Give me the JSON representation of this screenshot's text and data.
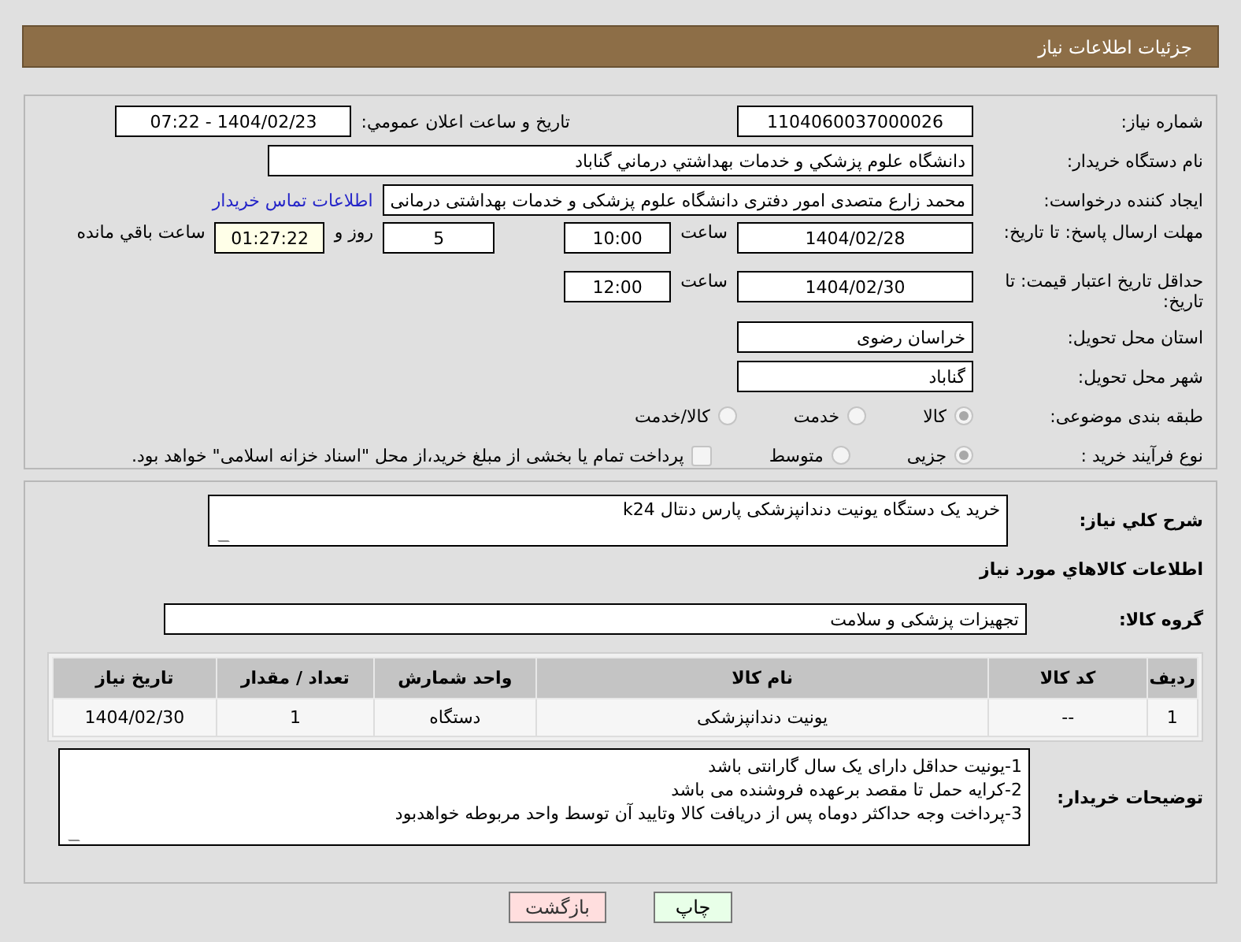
{
  "header": {
    "title": "جزئیات اطلاعات نیاز"
  },
  "need_number": {
    "label": "شماره نیاز:",
    "value": "1104060037000026"
  },
  "announce": {
    "label": "تاریخ و ساعت اعلان عمومي:",
    "value": "1404/02/23 - 07:22"
  },
  "buyer_org": {
    "label": "نام دستگاه خریدار:",
    "value": "دانشگاه علوم پزشكي و خدمات بهداشتي درماني گناباد"
  },
  "creator": {
    "label": "ایجاد کننده درخواست:",
    "value": "محمد زارع متصدی امور دفتری دانشگاه علوم پزشکی و خدمات بهداشتی درمانی",
    "link": "اطلاعات تماس خریدار"
  },
  "deadline": {
    "label": "مهلت ارسال پاسخ: تا تاریخ:",
    "date": "1404/02/28",
    "time_label": "ساعت",
    "time": "10:00",
    "days": "5",
    "days_label": "روز و",
    "remaining": "01:27:22",
    "remaining_label": "ساعت باقي مانده"
  },
  "validity": {
    "label": "حداقل تاریخ اعتبار قیمت: تا تاریخ:",
    "date": "1404/02/30",
    "time_label": "ساعت",
    "time": "12:00"
  },
  "province": {
    "label": "استان محل تحویل:",
    "value": "خراسان رضوی"
  },
  "city": {
    "label": "شهر محل تحویل:",
    "value": "گناباد"
  },
  "category": {
    "label": "طبقه بندی موضوعی:",
    "options": [
      {
        "label": "کالا",
        "selected": true
      },
      {
        "label": "خدمت",
        "selected": false
      },
      {
        "label": "کالا/خدمت",
        "selected": false
      }
    ]
  },
  "process": {
    "label": "نوع فرآیند خرید :",
    "options": [
      {
        "label": "جزیی",
        "selected": true
      },
      {
        "label": "متوسط",
        "selected": false
      }
    ],
    "treasury": {
      "checked": false,
      "label": "پرداخت تمام یا بخشی از مبلغ خرید،از محل \"اسناد خزانه اسلامی\" خواهد بود."
    }
  },
  "description": {
    "label": "شرح کلي نياز:",
    "value": "خرید یک دستگاه یونیت دندانپزشکی پارس دنتال k24"
  },
  "items_title": "اطلاعات کالاهاي مورد نياز",
  "goods_group": {
    "label": "گروه کالا:",
    "value": "تجهیزات پزشکی و سلامت"
  },
  "table": {
    "columns": [
      "ردیف",
      "کد کالا",
      "نام کالا",
      "واحد شمارش",
      "تعداد / مقدار",
      "تاریخ نیاز"
    ],
    "rows": [
      [
        "1",
        "--",
        "یونیت دندانپزشکی",
        "دستگاه",
        "1",
        "1404/02/30"
      ]
    ]
  },
  "buyer_notes": {
    "label": "توضیحات خریدار:",
    "lines": [
      "1-یونیت حداقل دارای یک سال گارانتی باشد",
      "2-کرایه حمل تا مقصد برعهده فروشنده می باشد",
      "3-پرداخت وجه حداکثر دوماه پس از دریافت کالا وتایید آن توسط واحد مربوطه خواهدبود"
    ]
  },
  "buttons": [
    {
      "label": "چاپ",
      "kind": "print"
    },
    {
      "label": "بازگشت",
      "kind": "back"
    }
  ]
}
